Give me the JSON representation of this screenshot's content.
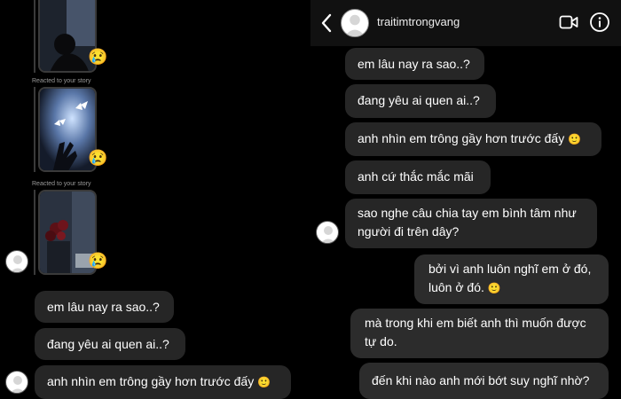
{
  "colors": {
    "background": "#000000",
    "bubble": "#262626",
    "header": "#111111",
    "text": "#ffffff"
  },
  "left_panel": {
    "story_replies": [
      {
        "caption": "Reacted to your story",
        "reaction": "😢"
      },
      {
        "caption": "Reacted to your story",
        "reaction": "😢"
      },
      {
        "caption": "",
        "reaction": "😢"
      }
    ],
    "messages": [
      {
        "text": "em lâu nay ra sao..?"
      },
      {
        "text": "đang yêu ai quen ai..?"
      },
      {
        "text": "anh nhìn em trông gầy hơn trước đấy",
        "emoji": "🙂"
      }
    ]
  },
  "right_panel": {
    "header": {
      "username": "traitimtrongvang",
      "icons": [
        "back-icon",
        "avatar",
        "video-call-icon",
        "info-icon"
      ]
    },
    "received": [
      {
        "text": "em lâu nay ra sao..?"
      },
      {
        "text": "đang yêu ai quen ai..?"
      },
      {
        "text": "anh nhìn em trông gầy hơn trước đấy",
        "emoji": "🙂"
      },
      {
        "text": "anh cứ thắc mắc mãi"
      },
      {
        "text": "sao nghe câu chia tay em bình tâm như người đi trên dây?"
      }
    ],
    "sent": [
      {
        "text": "bởi vì anh luôn nghĩ em ở đó, luôn ở đó.",
        "emoji": "🙂"
      },
      {
        "text": "mà trong khi em biết anh thì muốn được tự do."
      },
      {
        "text": "đến khi nào anh mới bớt suy nghĩ nhờ?"
      }
    ]
  }
}
